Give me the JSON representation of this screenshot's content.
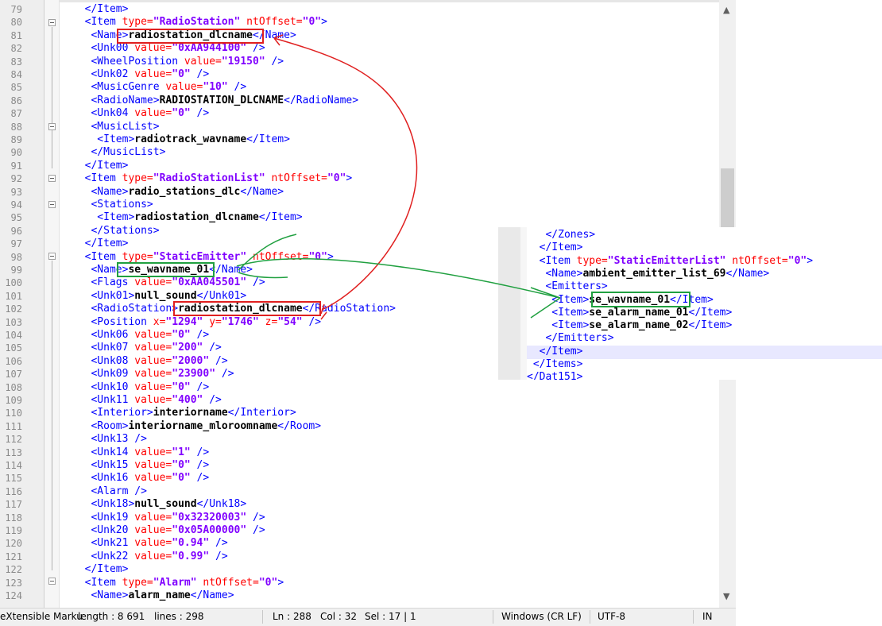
{
  "editor": {
    "lines": [
      {
        "num": "79",
        "segs": [
          [
            "t",
            "  </Item>"
          ]
        ]
      },
      {
        "num": "80",
        "segs": [
          [
            "t",
            "  <Item "
          ],
          [
            "a",
            "type="
          ],
          [
            "v",
            "\"RadioStation\""
          ],
          [
            "a",
            " ntOffset="
          ],
          [
            "v",
            "\"0\""
          ],
          [
            "t",
            ">"
          ]
        ]
      },
      {
        "num": "81",
        "segs": [
          [
            "t",
            "   <Name>"
          ],
          [
            "x",
            "radiostation_dlcname"
          ],
          [
            "t",
            "</Name>"
          ]
        ]
      },
      {
        "num": "82",
        "segs": [
          [
            "t",
            "   <Unk00 "
          ],
          [
            "a",
            "value="
          ],
          [
            "v",
            "\"0xAA944100\""
          ],
          [
            "t",
            " />"
          ]
        ]
      },
      {
        "num": "83",
        "segs": [
          [
            "t",
            "   <WheelPosition "
          ],
          [
            "a",
            "value="
          ],
          [
            "v",
            "\"19150\""
          ],
          [
            "t",
            " />"
          ]
        ]
      },
      {
        "num": "84",
        "segs": [
          [
            "t",
            "   <Unk02 "
          ],
          [
            "a",
            "value="
          ],
          [
            "v",
            "\"0\""
          ],
          [
            "t",
            " />"
          ]
        ]
      },
      {
        "num": "85",
        "segs": [
          [
            "t",
            "   <MusicGenre "
          ],
          [
            "a",
            "value="
          ],
          [
            "v",
            "\"10\""
          ],
          [
            "t",
            " />"
          ]
        ]
      },
      {
        "num": "86",
        "segs": [
          [
            "t",
            "   <RadioName>"
          ],
          [
            "x",
            "RADIOSTATION_DLCNAME"
          ],
          [
            "t",
            "</RadioName>"
          ]
        ]
      },
      {
        "num": "87",
        "segs": [
          [
            "t",
            "   <Unk04 "
          ],
          [
            "a",
            "value="
          ],
          [
            "v",
            "\"0\""
          ],
          [
            "t",
            " />"
          ]
        ]
      },
      {
        "num": "88",
        "segs": [
          [
            "t",
            "   <MusicList>"
          ]
        ]
      },
      {
        "num": "89",
        "segs": [
          [
            "t",
            "    <Item>"
          ],
          [
            "x",
            "radiotrack_wavname"
          ],
          [
            "t",
            "</Item>"
          ]
        ]
      },
      {
        "num": "90",
        "segs": [
          [
            "t",
            "   </MusicList>"
          ]
        ]
      },
      {
        "num": "91",
        "segs": [
          [
            "t",
            "  </Item>"
          ]
        ]
      },
      {
        "num": "92",
        "segs": [
          [
            "t",
            "  <Item "
          ],
          [
            "a",
            "type="
          ],
          [
            "v",
            "\"RadioStationList\""
          ],
          [
            "a",
            " ntOffset="
          ],
          [
            "v",
            "\"0\""
          ],
          [
            "t",
            ">"
          ]
        ]
      },
      {
        "num": "93",
        "segs": [
          [
            "t",
            "   <Name>"
          ],
          [
            "x",
            "radio_stations_dlc"
          ],
          [
            "t",
            "</Name>"
          ]
        ]
      },
      {
        "num": "94",
        "segs": [
          [
            "t",
            "   <Stations>"
          ]
        ]
      },
      {
        "num": "95",
        "segs": [
          [
            "t",
            "    <Item>"
          ],
          [
            "x",
            "radiostation_dlcname"
          ],
          [
            "t",
            "</Item>"
          ]
        ]
      },
      {
        "num": "96",
        "segs": [
          [
            "t",
            "   </Stations>"
          ]
        ]
      },
      {
        "num": "97",
        "segs": [
          [
            "t",
            "  </Item>"
          ]
        ]
      },
      {
        "num": "98",
        "segs": [
          [
            "t",
            "  <Item "
          ],
          [
            "a",
            "type="
          ],
          [
            "v",
            "\"StaticEmitter\""
          ],
          [
            "a",
            " ntOffset="
          ],
          [
            "v",
            "\"0\""
          ],
          [
            "t",
            ">"
          ]
        ]
      },
      {
        "num": "99",
        "segs": [
          [
            "t",
            "   <Name>"
          ],
          [
            "x",
            "se_wavname_01"
          ],
          [
            "t",
            "</Name>"
          ]
        ]
      },
      {
        "num": "100",
        "segs": [
          [
            "t",
            "   <Flags "
          ],
          [
            "a",
            "value="
          ],
          [
            "v",
            "\"0xAA045501\""
          ],
          [
            "t",
            " />"
          ]
        ]
      },
      {
        "num": "101",
        "segs": [
          [
            "t",
            "   <Unk01>"
          ],
          [
            "x",
            "null_sound"
          ],
          [
            "t",
            "</Unk01>"
          ]
        ]
      },
      {
        "num": "102",
        "segs": [
          [
            "t",
            "   <RadioStation>"
          ],
          [
            "x",
            "radiostation_dlcname"
          ],
          [
            "t",
            "</RadioStation>"
          ]
        ]
      },
      {
        "num": "103",
        "segs": [
          [
            "t",
            "   <Position "
          ],
          [
            "a",
            "x="
          ],
          [
            "v",
            "\"1294\""
          ],
          [
            "a",
            " y="
          ],
          [
            "v",
            "\"1746\""
          ],
          [
            "a",
            " z="
          ],
          [
            "v",
            "\"54\""
          ],
          [
            "t",
            " />"
          ]
        ]
      },
      {
        "num": "104",
        "segs": [
          [
            "t",
            "   <Unk06 "
          ],
          [
            "a",
            "value="
          ],
          [
            "v",
            "\"0\""
          ],
          [
            "t",
            " />"
          ]
        ]
      },
      {
        "num": "105",
        "segs": [
          [
            "t",
            "   <Unk07 "
          ],
          [
            "a",
            "value="
          ],
          [
            "v",
            "\"200\""
          ],
          [
            "t",
            " />"
          ]
        ]
      },
      {
        "num": "106",
        "segs": [
          [
            "t",
            "   <Unk08 "
          ],
          [
            "a",
            "value="
          ],
          [
            "v",
            "\"2000\""
          ],
          [
            "t",
            " />"
          ]
        ]
      },
      {
        "num": "107",
        "segs": [
          [
            "t",
            "   <Unk09 "
          ],
          [
            "a",
            "value="
          ],
          [
            "v",
            "\"23900\""
          ],
          [
            "t",
            " />"
          ]
        ]
      },
      {
        "num": "108",
        "segs": [
          [
            "t",
            "   <Unk10 "
          ],
          [
            "a",
            "value="
          ],
          [
            "v",
            "\"0\""
          ],
          [
            "t",
            " />"
          ]
        ]
      },
      {
        "num": "109",
        "segs": [
          [
            "t",
            "   <Unk11 "
          ],
          [
            "a",
            "value="
          ],
          [
            "v",
            "\"400\""
          ],
          [
            "t",
            " />"
          ]
        ]
      },
      {
        "num": "110",
        "segs": [
          [
            "t",
            "   <Interior>"
          ],
          [
            "x",
            "interiorname"
          ],
          [
            "t",
            "</Interior>"
          ]
        ]
      },
      {
        "num": "111",
        "segs": [
          [
            "t",
            "   <Room>"
          ],
          [
            "x",
            "interiorname_mloroomname"
          ],
          [
            "t",
            "</Room>"
          ]
        ]
      },
      {
        "num": "112",
        "segs": [
          [
            "t",
            "   <Unk13 />"
          ]
        ]
      },
      {
        "num": "113",
        "segs": [
          [
            "t",
            "   <Unk14 "
          ],
          [
            "a",
            "value="
          ],
          [
            "v",
            "\"1\""
          ],
          [
            "t",
            " />"
          ]
        ]
      },
      {
        "num": "114",
        "segs": [
          [
            "t",
            "   <Unk15 "
          ],
          [
            "a",
            "value="
          ],
          [
            "v",
            "\"0\""
          ],
          [
            "t",
            " />"
          ]
        ]
      },
      {
        "num": "115",
        "segs": [
          [
            "t",
            "   <Unk16 "
          ],
          [
            "a",
            "value="
          ],
          [
            "v",
            "\"0\""
          ],
          [
            "t",
            " />"
          ]
        ]
      },
      {
        "num": "116",
        "segs": [
          [
            "t",
            "   <Alarm />"
          ]
        ]
      },
      {
        "num": "117",
        "segs": [
          [
            "t",
            "   <Unk18>"
          ],
          [
            "x",
            "null_sound"
          ],
          [
            "t",
            "</Unk18>"
          ]
        ]
      },
      {
        "num": "118",
        "segs": [
          [
            "t",
            "   <Unk19 "
          ],
          [
            "a",
            "value="
          ],
          [
            "v",
            "\"0x32320003\""
          ],
          [
            "t",
            " />"
          ]
        ]
      },
      {
        "num": "119",
        "segs": [
          [
            "t",
            "   <Unk20 "
          ],
          [
            "a",
            "value="
          ],
          [
            "v",
            "\"0x05A00000\""
          ],
          [
            "t",
            " />"
          ]
        ]
      },
      {
        "num": "120",
        "segs": [
          [
            "t",
            "   <Unk21 "
          ],
          [
            "a",
            "value="
          ],
          [
            "v",
            "\"0.94\""
          ],
          [
            "t",
            " />"
          ]
        ]
      },
      {
        "num": "121",
        "segs": [
          [
            "t",
            "   <Unk22 "
          ],
          [
            "a",
            "value="
          ],
          [
            "v",
            "\"0.99\""
          ],
          [
            "t",
            " />"
          ]
        ]
      },
      {
        "num": "122",
        "segs": [
          [
            "t",
            "  </Item>"
          ]
        ]
      },
      {
        "num": "123",
        "segs": [
          [
            "t",
            "  <Item "
          ],
          [
            "a",
            "type="
          ],
          [
            "v",
            "\"Alarm\""
          ],
          [
            "a",
            " ntOffset="
          ],
          [
            "v",
            "\"0\""
          ],
          [
            "t",
            ">"
          ]
        ]
      },
      {
        "num": "124",
        "segs": [
          [
            "t",
            "   <Name>"
          ],
          [
            "x",
            "alarm_name"
          ],
          [
            "t",
            "</Name>"
          ]
        ]
      }
    ]
  },
  "inset": {
    "lines": [
      {
        "segs": [
          [
            "t",
            "   </Zones>"
          ]
        ]
      },
      {
        "segs": [
          [
            "t",
            "  </Item>"
          ]
        ]
      },
      {
        "segs": [
          [
            "t",
            "  <Item "
          ],
          [
            "a",
            "type="
          ],
          [
            "v",
            "\"StaticEmitterList\""
          ],
          [
            "a",
            " ntOffset="
          ],
          [
            "v",
            "\"0\""
          ],
          [
            "t",
            ">"
          ]
        ]
      },
      {
        "segs": [
          [
            "t",
            "   <Name>"
          ],
          [
            "x",
            "ambient_emitter_list_69"
          ],
          [
            "t",
            "</Name>"
          ]
        ]
      },
      {
        "segs": [
          [
            "t",
            "   <Emitters>"
          ]
        ]
      },
      {
        "segs": [
          [
            "t",
            "    <Item>"
          ],
          [
            "x",
            "se_wavname_01"
          ],
          [
            "t",
            "</Item>"
          ]
        ]
      },
      {
        "segs": [
          [
            "t",
            "    <Item>"
          ],
          [
            "x",
            "se_alarm_name_01"
          ],
          [
            "t",
            "</Item>"
          ]
        ]
      },
      {
        "segs": [
          [
            "t",
            "    <Item>"
          ],
          [
            "x",
            "se_alarm_name_02"
          ],
          [
            "t",
            "</Item>"
          ]
        ]
      },
      {
        "segs": [
          [
            "t",
            "   </Emitters>"
          ]
        ]
      },
      {
        "segs": [
          [
            "t",
            "  </Item>"
          ]
        ]
      },
      {
        "segs": [
          [
            "t",
            " </Items>"
          ]
        ]
      },
      {
        "segs": [
          [
            "t",
            "</Dat151>"
          ]
        ]
      }
    ]
  },
  "status": {
    "filetype": "eXtensible Marku",
    "length": "length : 8 691",
    "lines": "lines : 298",
    "ln": "Ln : 288",
    "col": "Col : 32",
    "sel": "Sel : 17 | 1",
    "eol": "Windows (CR LF)",
    "encoding": "UTF-8",
    "mode": "IN"
  },
  "scrollbar": {
    "up_icon": "chevron-up-icon",
    "down_icon": "chevron-down-icon"
  },
  "colors": {
    "tag": "#0000ff",
    "attr": "#ff0000",
    "value": "#8000ff",
    "text": "#000000",
    "annotation_red": "#e02020",
    "annotation_green": "#20a040"
  }
}
